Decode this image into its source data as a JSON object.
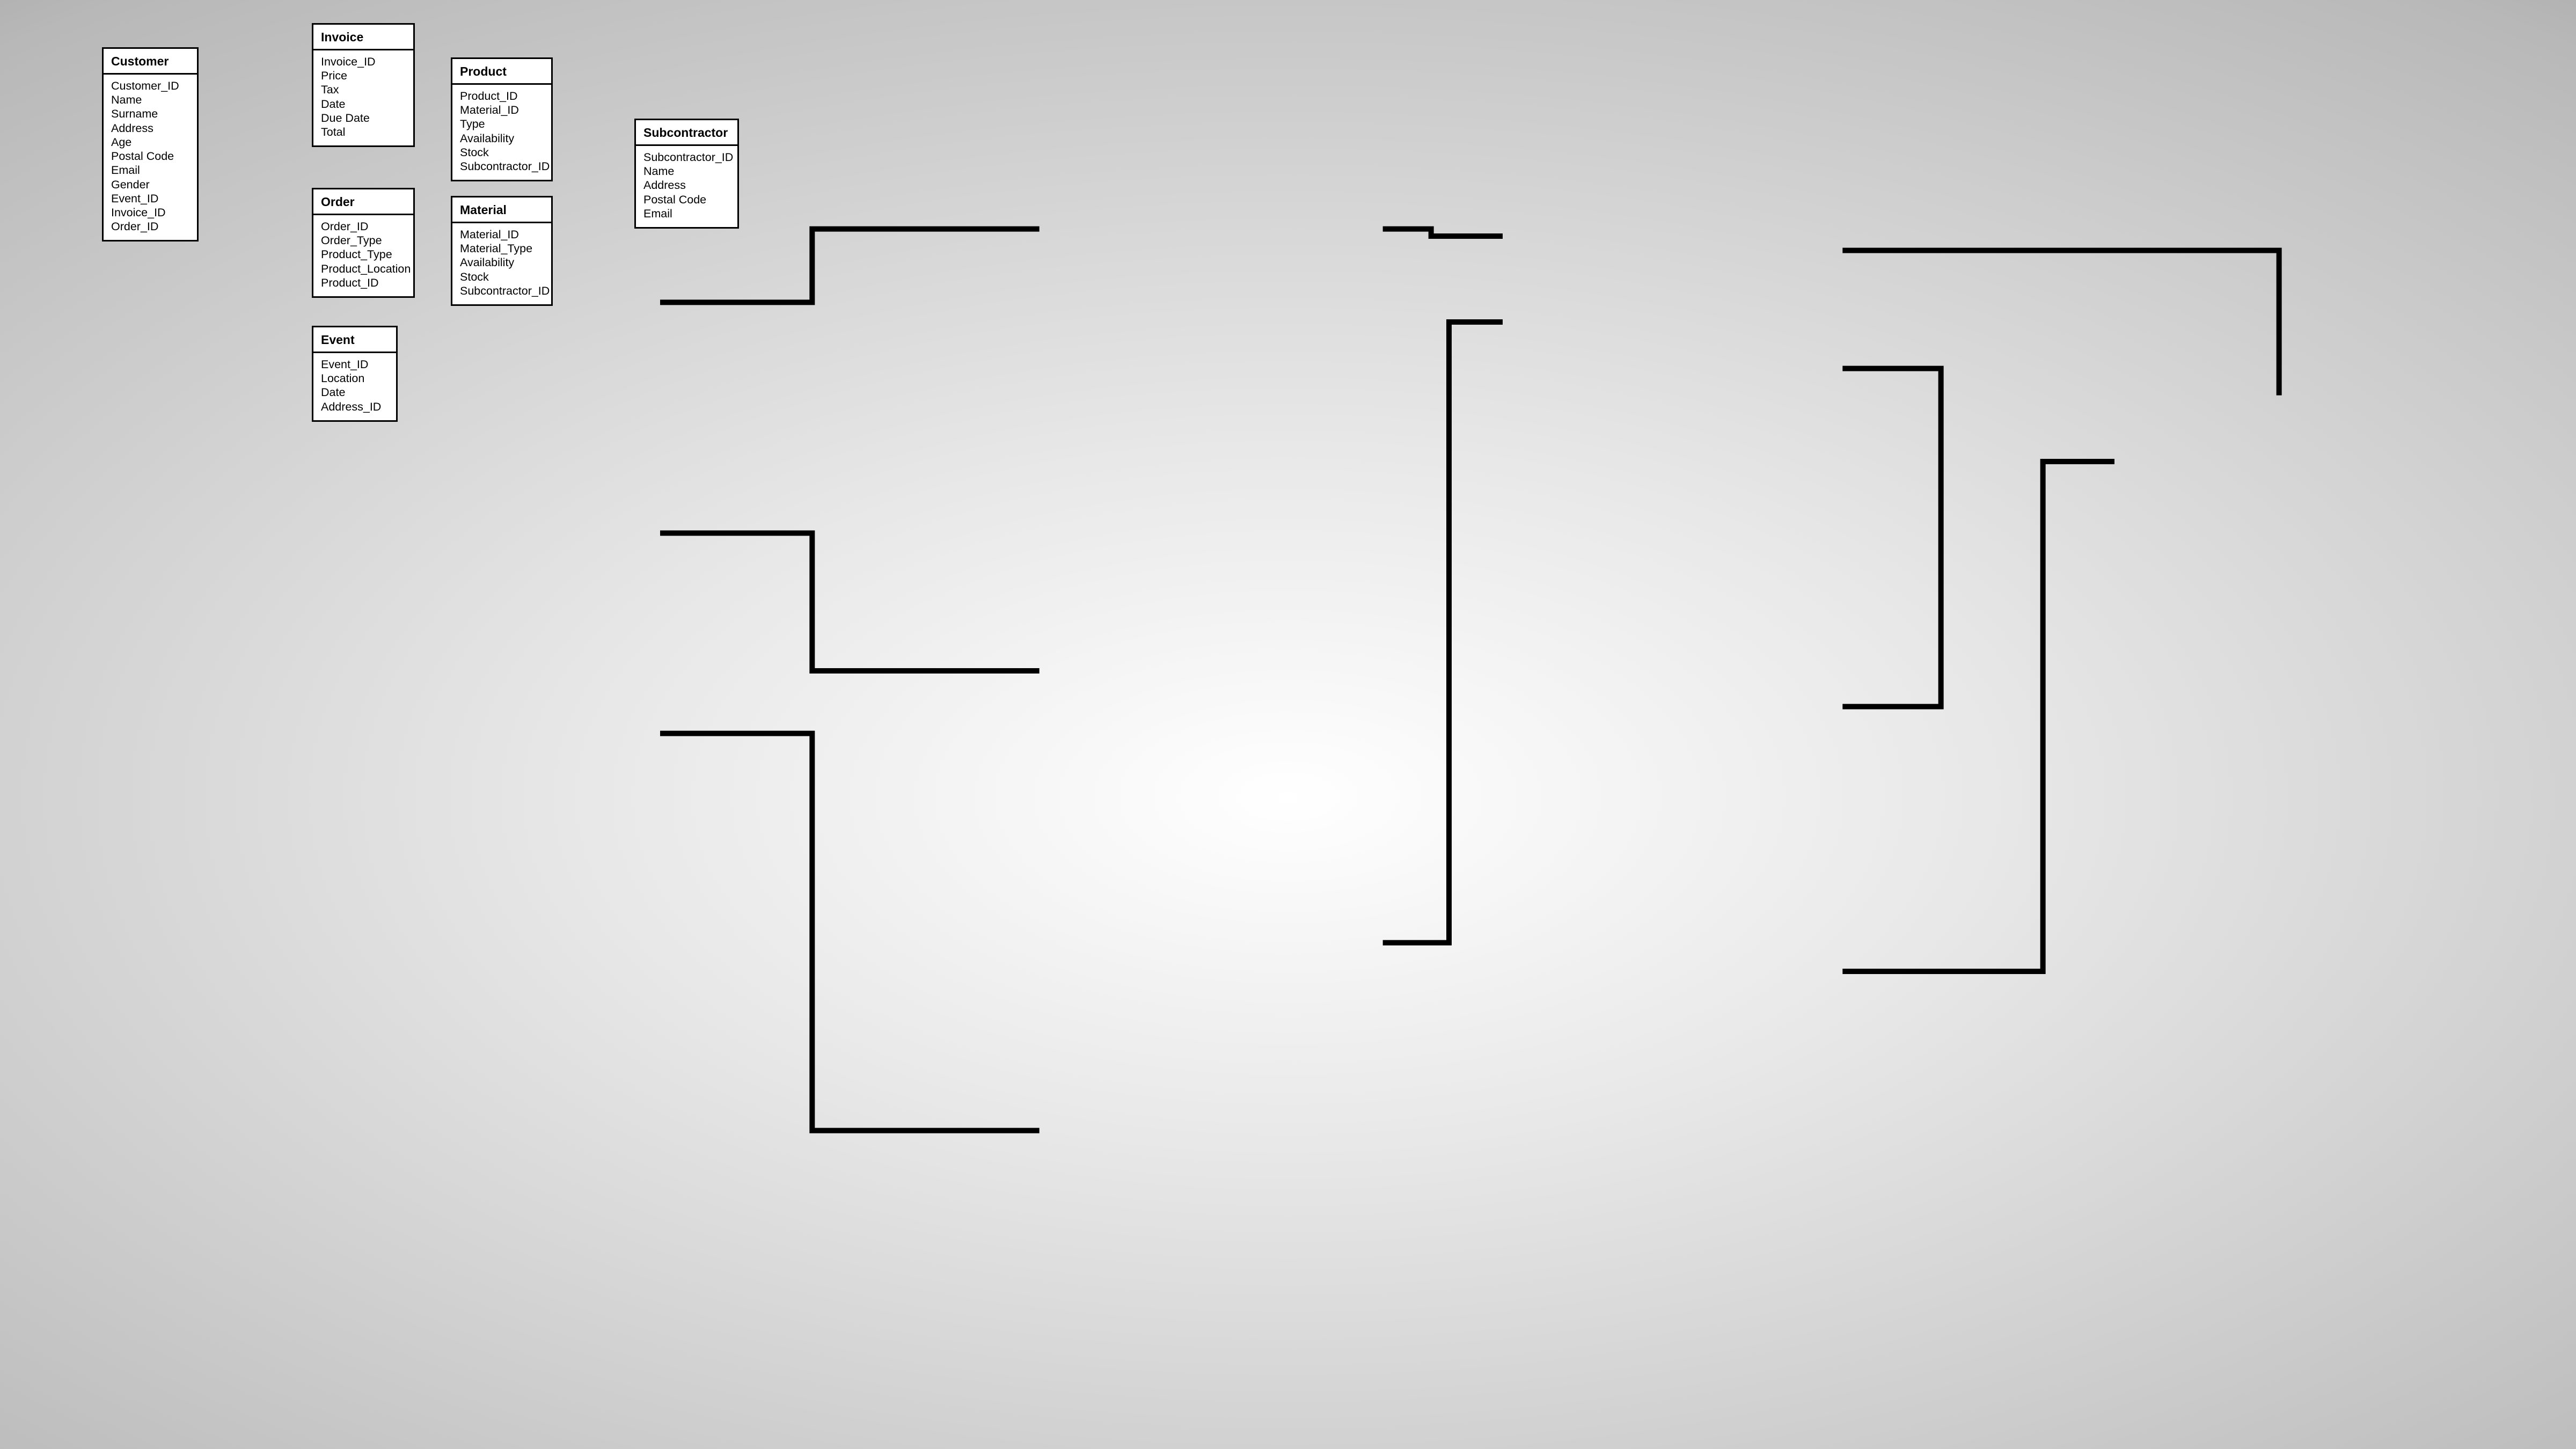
{
  "entities": {
    "customer": {
      "title": "Customer",
      "fields": [
        "Customer_ID",
        "Name",
        "Surname",
        "Address",
        "Age",
        "Postal Code",
        "Email",
        "Gender",
        "Event_ID",
        "Invoice_ID",
        "Order_ID"
      ]
    },
    "invoice": {
      "title": "Invoice",
      "fields": [
        "Invoice_ID",
        "Price",
        "Tax",
        "Date",
        "Due Date",
        "Total"
      ]
    },
    "order": {
      "title": "Order",
      "fields": [
        "Order_ID",
        "Order_Type",
        "Product_Type",
        "Product_Location",
        "Product_ID"
      ]
    },
    "event": {
      "title": "Event",
      "fields": [
        "Event_ID",
        "Location",
        "Date",
        "Address_ID"
      ]
    },
    "product": {
      "title": "Product",
      "fields": [
        "Product_ID",
        "Material_ID",
        "Type",
        "Availability",
        "Stock",
        "Subcontractor_ID"
      ]
    },
    "material": {
      "title": "Material",
      "fields": [
        "Material_ID",
        "Material_Type",
        "Availability",
        "Stock",
        "Subcontractor_ID"
      ]
    },
    "subcontractor": {
      "title": "Subcontractor",
      "fields": [
        "Subcontractor_ID",
        "Name",
        "Address",
        "Postal Code",
        "Email"
      ]
    }
  }
}
